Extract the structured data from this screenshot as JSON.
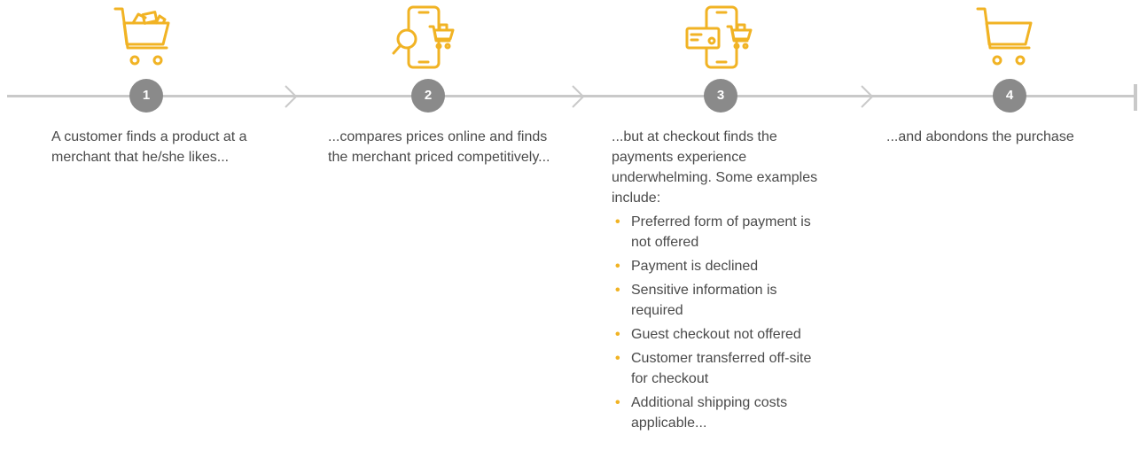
{
  "accent_color": "#f1b324",
  "line_color": "#c9c9c9",
  "badge_color": "#8a8a8a",
  "steps": [
    {
      "number": "1",
      "icon": "shopping-cart-with-items-icon",
      "text": "A customer finds a product at a merchant that he/she likes..."
    },
    {
      "number": "2",
      "icon": "phone-search-compare-icon",
      "text": "...compares prices online and finds the merchant priced competitively..."
    },
    {
      "number": "3",
      "icon": "phone-card-payment-icon",
      "text": "...but at checkout finds the payments experience underwhelming. Some examples include:",
      "bullets": [
        "Preferred form of payment is not offered",
        "Payment is declined",
        "Sensitive information is required",
        "Guest checkout not offered",
        "Customer transferred off-site for checkout",
        "Additional shipping costs applicable..."
      ]
    },
    {
      "number": "4",
      "icon": "empty-shopping-cart-icon",
      "text": "...and abondons the purchase"
    }
  ]
}
